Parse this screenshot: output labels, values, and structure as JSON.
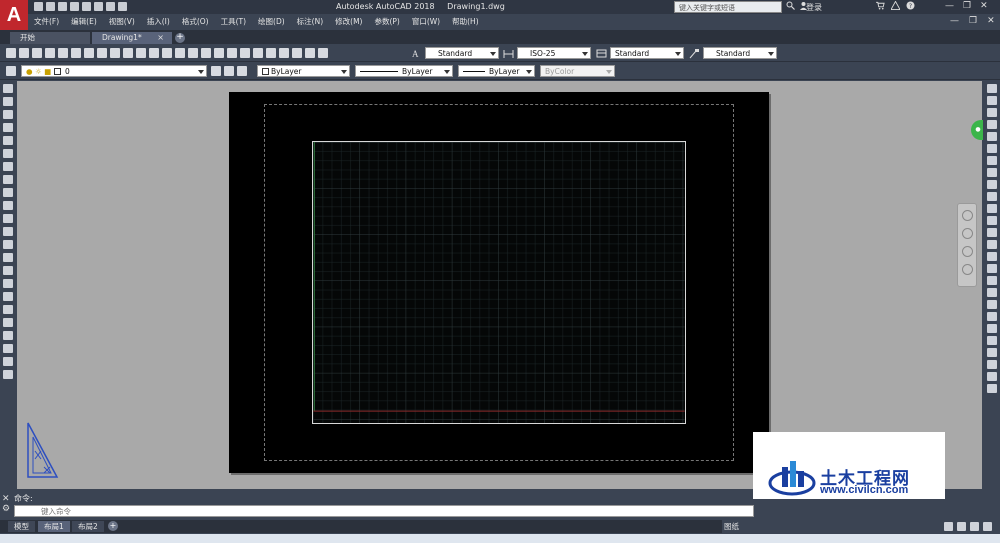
{
  "app": {
    "name": "Autodesk AutoCAD 2018",
    "file": "Drawing1.dwg",
    "logo_letter": "A"
  },
  "search": {
    "placeholder": "键入关键字或短语"
  },
  "account": {
    "login_label": "登录"
  },
  "menu": [
    "文件(F)",
    "编辑(E)",
    "视图(V)",
    "插入(I)",
    "格式(O)",
    "工具(T)",
    "绘图(D)",
    "标注(N)",
    "修改(M)",
    "参数(P)",
    "窗口(W)",
    "帮助(H)"
  ],
  "file_tabs": {
    "start": "开始",
    "drawing": "Drawing1*",
    "close": "×",
    "add": "+"
  },
  "styles": {
    "text_style": "Standard",
    "dim_style": "ISO-25",
    "table_style": "Standard",
    "mleader_style": "Standard"
  },
  "layers": {
    "current_layer": "0",
    "color": "ByLayer",
    "linetype": "ByLayer",
    "lineweight": "ByLayer",
    "plot_style": "ByColor"
  },
  "command": {
    "history": "命令:",
    "placeholder": "键入命令"
  },
  "layout_tabs": {
    "model": "模型",
    "layout1": "布局1",
    "layout2": "布局2",
    "add": "+"
  },
  "status": {
    "paper_label": "图纸"
  },
  "watermark": {
    "title": "土木工程网",
    "url": "www.civilcn.com"
  },
  "colors": {
    "accent": "#c0272d",
    "chrome": "#3b4453",
    "paper_bg": "#000000",
    "model_bg": "#a9a9a9",
    "watermark_blue": "#1a3fa0"
  }
}
